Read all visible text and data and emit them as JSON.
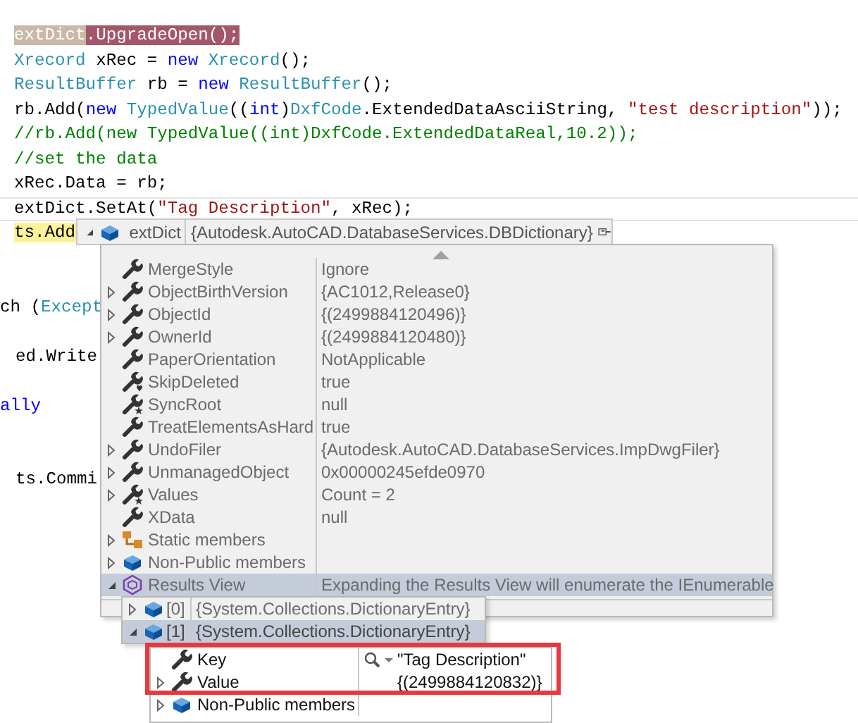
{
  "code_lines": [
    {
      "tokens": [
        {
          "text": "extDict",
          "kind": "reference"
        },
        {
          "text": ".UpgradeOpen();",
          "kind": "statement"
        }
      ]
    },
    {
      "tokens": [
        {
          "text": "Xrecord",
          "kind": "type"
        },
        {
          "text": " xRec = ",
          "kind": "plain"
        },
        {
          "text": "new ",
          "kind": "keyword"
        },
        {
          "text": "Xrecord",
          "kind": "type"
        },
        {
          "text": "();",
          "kind": "plain"
        }
      ]
    },
    {
      "tokens": [
        {
          "text": "ResultBuffer",
          "kind": "type"
        },
        {
          "text": " rb = ",
          "kind": "plain"
        },
        {
          "text": "new ",
          "kind": "keyword"
        },
        {
          "text": "ResultBuffer",
          "kind": "type"
        },
        {
          "text": "();",
          "kind": "plain"
        }
      ]
    },
    {
      "tokens": [
        {
          "text": "rb.Add(",
          "kind": "plain"
        },
        {
          "text": "new ",
          "kind": "keyword"
        },
        {
          "text": "TypedValue",
          "kind": "type"
        },
        {
          "text": "((",
          "kind": "plain"
        },
        {
          "text": "int",
          "kind": "keyword"
        },
        {
          "text": ")",
          "kind": "plain"
        },
        {
          "text": "DxfCode",
          "kind": "type"
        },
        {
          "text": ".ExtendedDataAsciiString, ",
          "kind": "plain"
        },
        {
          "text": "\"test description\"",
          "kind": "string"
        },
        {
          "text": "));",
          "kind": "plain"
        }
      ]
    },
    {
      "tokens": [
        {
          "text": "//rb.Add(new TypedValue((int)DxfCode.ExtendedDataReal,10.2));",
          "kind": "comment"
        }
      ]
    },
    {
      "tokens": [
        {
          "text": "//set the data",
          "kind": "comment"
        }
      ]
    },
    {
      "tokens": [
        {
          "text": "xRec.Data = rb;",
          "kind": "plain"
        }
      ]
    },
    {
      "current": true,
      "tokens": [
        {
          "text": "extDict.SetAt(",
          "kind": "plain"
        },
        {
          "text": "\"Tag Description\"",
          "kind": "string"
        },
        {
          "text": ", xRec);",
          "kind": "plain"
        }
      ]
    },
    {
      "tokens": [
        {
          "text": "ts.Add",
          "kind": "next"
        }
      ]
    },
    {
      "tokens": [
        {
          "text": "ch (",
          "kind": "plain"
        },
        {
          "text": "Except",
          "kind": "type"
        }
      ]
    },
    {
      "tokens": [
        {
          "text": "ed.Write",
          "kind": "plain"
        }
      ]
    },
    {
      "tokens": [
        {
          "text": "ally",
          "kind": "keyword"
        }
      ]
    },
    {
      "tokens": [
        {
          "text": "ts.Commi",
          "kind": "plain"
        }
      ]
    }
  ],
  "datatip": {
    "expanded": true,
    "name": "extDict",
    "value": "{Autodesk.AutoCAD.DatabaseServices.DBDictionary}",
    "members": [
      {
        "name": "MergeStyle",
        "value": "Ignore",
        "kind": "property",
        "selected": false
      },
      {
        "name": "ObjectBirthVersion",
        "value": "{AC1012,Release0}",
        "kind": "property",
        "expanded": false,
        "selected": false
      },
      {
        "name": "ObjectId",
        "value": "{(2499884120496)}",
        "kind": "property",
        "expanded": false,
        "selected": false
      },
      {
        "name": "OwnerId",
        "value": "{(2499884120480)}",
        "kind": "property",
        "expanded": false,
        "selected": false
      },
      {
        "name": "PaperOrientation",
        "value": "NotApplicable",
        "kind": "property",
        "selected": false
      },
      {
        "name": "SkipDeleted",
        "value": "true",
        "kind": "protected",
        "selected": false
      },
      {
        "name": "SyncRoot",
        "value": "null",
        "kind": "internal",
        "selected": false
      },
      {
        "name": "TreatElementsAsHard",
        "value": "true",
        "kind": "property",
        "selected": false
      },
      {
        "name": "UndoFiler",
        "value": "{Autodesk.AutoCAD.DatabaseServices.ImpDwgFiler}",
        "kind": "property",
        "expanded": false,
        "selected": false
      },
      {
        "name": "UnmanagedObject",
        "value": "0x00000245efde0970",
        "kind": "property",
        "expanded": false,
        "selected": false
      },
      {
        "name": "Values",
        "value": "Count = 2",
        "kind": "internal",
        "expanded": false,
        "selected": false
      },
      {
        "name": "XData",
        "value": "null",
        "kind": "property",
        "selected": false
      },
      {
        "name": "Static members",
        "kind": "static",
        "expanded": false,
        "selected": false
      },
      {
        "name": "Non-Public members",
        "kind": "nonpublic",
        "expanded": false,
        "selected": false
      },
      {
        "name": "Results View",
        "value": "Expanding the Results View will enumerate the IEnumerable",
        "kind": "results",
        "expanded": true,
        "selected": true
      }
    ]
  },
  "results": [
    {
      "name": "[0]",
      "value": "{System.Collections.DictionaryEntry}",
      "expanded": false,
      "selected": false
    },
    {
      "name": "[1]",
      "value": "{System.Collections.DictionaryEntry}",
      "expanded": true,
      "selected": true
    }
  ],
  "entry": [
    {
      "name": "Key",
      "value": "\"Tag Description\"",
      "kind": "property",
      "visualizer": true
    },
    {
      "name": "Value",
      "value": "{(2499884120832)}",
      "kind": "property",
      "expanded": false,
      "visualizer": false
    },
    {
      "name": "Non-Public members",
      "kind": "nonpublic",
      "expanded": false,
      "visualizer": false
    }
  ],
  "highlight_box": {
    "color": "#e8383f"
  }
}
